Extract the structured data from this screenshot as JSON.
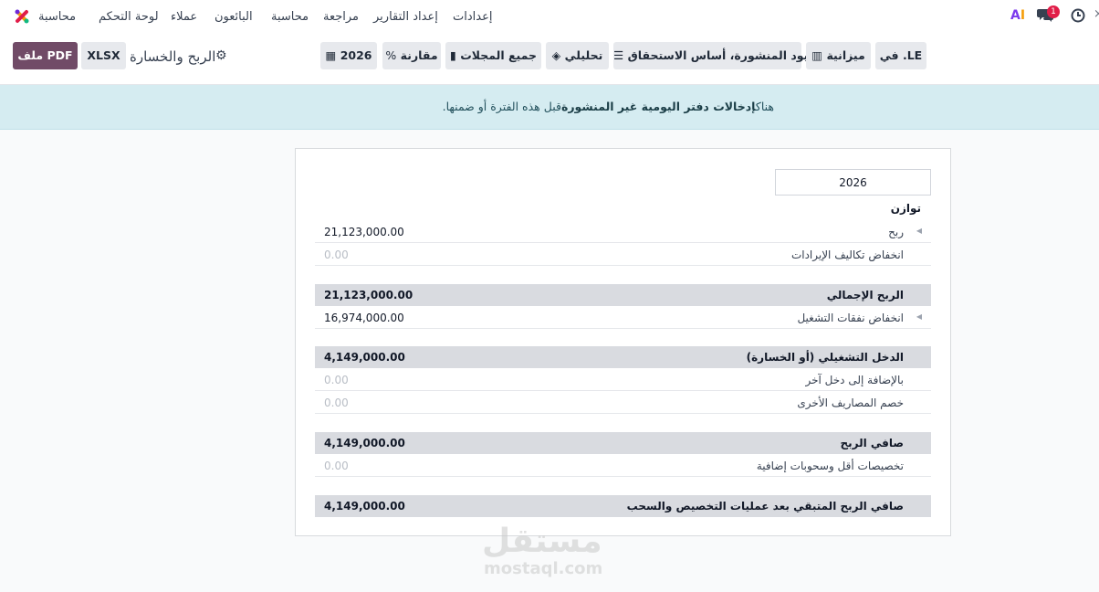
{
  "nav": {
    "app_name": "محاسبة",
    "menu": [
      "لوحة التحكم",
      "عملاء",
      "البائعون",
      "محاسبة",
      "مراجعة",
      "إعداد التقارير",
      "إعدادات"
    ],
    "notification_count": "1"
  },
  "toolbar": {
    "pdf_label": "ملف PDF",
    "xlsx_label": "XLSX",
    "report_title": "الربح والخسارة",
    "filters": {
      "date": "2026",
      "comparison": "مقارنة",
      "journals": "جميع المجلات",
      "analytic": "تحليلي",
      "entries": "القيود المنشورة، أساس الاستحقاق",
      "budget": "ميزانية",
      "currency": "في .LE"
    }
  },
  "alert": {
    "prefix": "هناك",
    "bold": "إدخالات دفتر اليومية غير المنشورة",
    "suffix": "قبل هذه الفترة أو ضمنها."
  },
  "report": {
    "column_period": "2026",
    "column_header": "توازن",
    "rows": [
      {
        "label": "ربح",
        "value": "21,123,000.00"
      },
      {
        "label": "انخفاض تكاليف الإيرادات",
        "value": "0.00"
      },
      {
        "label": "الربح الإجمالي",
        "value": "21,123,000.00"
      },
      {
        "label": "انخفاض نفقات التشغيل",
        "value": "16,974,000.00"
      },
      {
        "label": "الدخل التشغيلي (أو الخسارة)",
        "value": "4,149,000.00"
      },
      {
        "label": "بالإضافة إلى دخل آخر",
        "value": "0.00"
      },
      {
        "label": "خصم المصاريف الأخرى",
        "value": "0.00"
      },
      {
        "label": "صافي الربح",
        "value": "4,149,000.00"
      },
      {
        "label": "تخصيصات أقل وسحوبات إضافية",
        "value": "0.00"
      },
      {
        "label": "صافي الربح المتبقي بعد عمليات التخصيص والسحب",
        "value": "4,149,000.00"
      }
    ]
  },
  "watermark": {
    "text": "مستقل",
    "sub": "mostaql.com"
  },
  "colors": {
    "primary": "#714b67",
    "alert_bg": "#d5ecf1",
    "total_row": "#d9dbe0"
  }
}
